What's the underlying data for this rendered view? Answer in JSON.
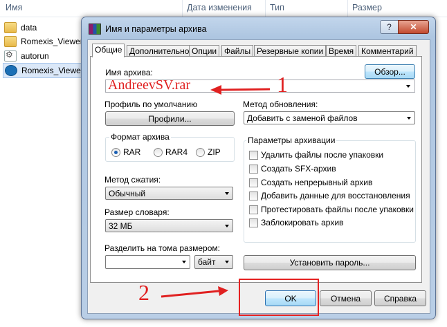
{
  "explorer": {
    "columns": [
      "Имя",
      "Дата изменения",
      "Тип",
      "Размер"
    ],
    "files": [
      {
        "name": "data",
        "icon": "folder-icon"
      },
      {
        "name": "Romexis_Viewer_",
        "icon": "folder-icon"
      },
      {
        "name": "autorun",
        "icon": "settings-file-icon"
      },
      {
        "name": "Romexis_Viewer_",
        "icon": "app-icon"
      }
    ]
  },
  "dialog": {
    "title": "Имя и параметры архива",
    "title_buttons": {
      "help": "?",
      "close": "✕"
    },
    "tabs": [
      "Общие",
      "Дополнительно",
      "Опции",
      "Файлы",
      "Резервные копии",
      "Время",
      "Комментарий"
    ],
    "active_tab": 0,
    "archive_name_label": "Имя архива:",
    "browse_button": "Обзор...",
    "archive_name_value": "AndreevSV.rar",
    "profile_label": "Профиль по умолчанию",
    "profiles_button": "Профили...",
    "update_method_label": "Метод обновления:",
    "update_method_value": "Добавить с заменой файлов",
    "format_group": {
      "title": "Формат архива",
      "options": [
        "RAR",
        "RAR4",
        "ZIP"
      ],
      "selected": "RAR"
    },
    "compression_label": "Метод сжатия:",
    "compression_value": "Обычный",
    "dictionary_label": "Размер словаря:",
    "dictionary_value": "32 МБ",
    "split_label": "Разделить на тома размером:",
    "split_value": "",
    "split_unit": "байт",
    "options_group": {
      "title": "Параметры архивации",
      "options": [
        "Удалить файлы после упаковки",
        "Создать SFX-архив",
        "Создать непрерывный архив",
        "Добавить данные для восстановления",
        "Протестировать файлы после упаковки",
        "Заблокировать архив"
      ]
    },
    "set_password_button": "Установить пароль...",
    "ok_button": "OK",
    "cancel_button": "Отмена",
    "help_button": "Справка"
  },
  "annotations": {
    "marker_1": "1",
    "marker_2": "2",
    "color": "#e02020"
  }
}
